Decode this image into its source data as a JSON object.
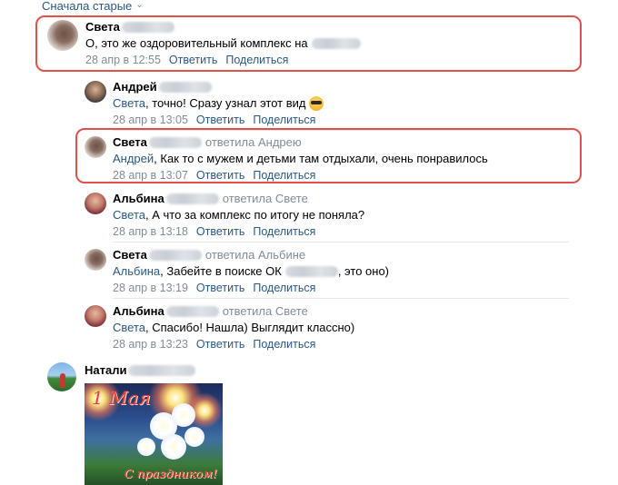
{
  "sort": {
    "label": "Сначала старые"
  },
  "actions": {
    "reply": "Ответить",
    "share": "Поделиться"
  },
  "comments": [
    {
      "author": "Света",
      "text": "О, это же оздоровительный комплекс на",
      "time": "28 апр в 12:55",
      "highlighted": true
    },
    {
      "author": "Андрей",
      "mention": "Света",
      "text": ", точно! Сразу узнал этот вид",
      "emoji": "smiling-face-with-sunglasses",
      "time": "28 апр в 13:05"
    },
    {
      "author": "Света",
      "replied_to": "ответила Андрею",
      "mention": "Андрей",
      "text": ", Как то с мужем и детьми там отдыхали, очень понравилось",
      "time": "28 апр в 13:07",
      "highlighted": true
    },
    {
      "author": "Альбина",
      "replied_to": "ответила Свете",
      "mention": "Света",
      "text": ", А что за комплекс по итогу не поняла?",
      "time": "28 апр в 13:18"
    },
    {
      "author": "Света",
      "replied_to": "ответила Альбине",
      "mention": "Альбина",
      "text": ", Забейте в поиске ОК",
      "text_after": ", это оно)",
      "time": "28 апр в 13:19"
    },
    {
      "author": "Альбина",
      "replied_to": "ответила Свете",
      "mention": "Света",
      "text": ", Спасибо! Нашла) Выглядит классно)",
      "time": "28 апр в 13:23"
    },
    {
      "author": "Натали",
      "attachment": {
        "title": "1 Мая",
        "caption": "С праздником!"
      }
    }
  ],
  "colors": {
    "link": "#2a5885",
    "meta": "#818c99",
    "highlight_border": "#e0514a",
    "separator": "#e7e8ec"
  }
}
